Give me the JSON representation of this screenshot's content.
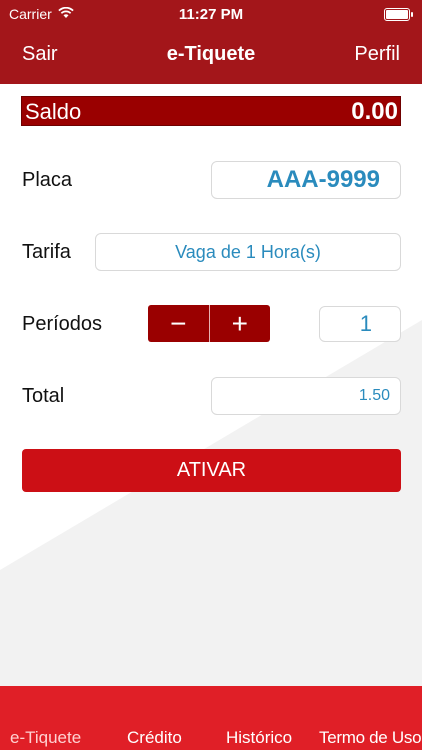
{
  "status_bar": {
    "carrier": "Carrier",
    "time": "11:27 PM"
  },
  "nav": {
    "left_label": "Sair",
    "title": "e-Tiquete",
    "right_label": "Perfil"
  },
  "saldo": {
    "label": "Saldo",
    "value": "0.00"
  },
  "form": {
    "placa": {
      "label": "Placa",
      "value": "AAA-9999"
    },
    "tarifa": {
      "label": "Tarifa",
      "value": "Vaga de 1 Hora(s)"
    },
    "periodos": {
      "label": "Períodos",
      "value": "1",
      "minus": "−",
      "plus": "+"
    },
    "total": {
      "label": "Total",
      "value": "1.50"
    }
  },
  "action": {
    "ativar_label": "ATIVAR"
  },
  "tabs": [
    {
      "label": "e-Tiquete",
      "active": true
    },
    {
      "label": "Crédito"
    },
    {
      "label": "Histórico"
    },
    {
      "label": "Termo de Uso"
    }
  ],
  "colors": {
    "brand": "#a3161a",
    "accent": "#2a8bbd",
    "button": "#cc0f15",
    "tabbar": "#e01f27"
  }
}
